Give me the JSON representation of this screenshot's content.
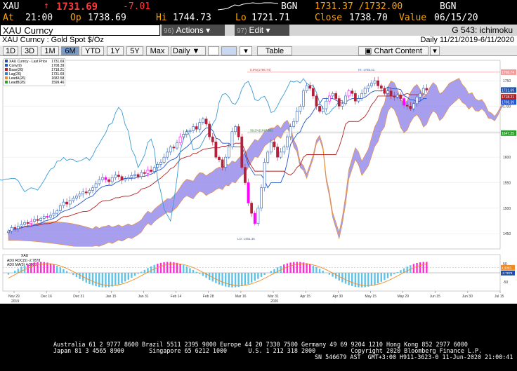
{
  "quote": {
    "ticker": "XAU",
    "arrow": "↑",
    "last": "1731.69",
    "change": "-7.01",
    "bgn_label": "BGN",
    "bid_ask": "1731.37 /1732.00",
    "bgn2": "BGN",
    "at_label": "At",
    "at_value": "21:00",
    "open_label": "Op",
    "open_value": "1738.69",
    "hi_label": "Hi",
    "hi_value": "1744.73",
    "lo_label": "Lo",
    "lo_value": "1721.71",
    "close_label": "Close",
    "close_value": "1738.70",
    "value_label": "Value",
    "value_date": "06/15/20"
  },
  "menu": {
    "security": "XAU Curncy",
    "actions_num": "96)",
    "actions_label": "Actions ▾",
    "edit_num": "97)",
    "edit_label": "Edit ▾",
    "function_title": "G 543: ichimoku"
  },
  "subbar": {
    "description": "XAU Curncy : Gold Spot   $/Oz",
    "period": "Daily   11/21/2019-6/11/2020"
  },
  "toolbar": {
    "buttons": [
      "1D",
      "3D",
      "1M",
      "6M",
      "YTD",
      "1Y",
      "5Y",
      "Max"
    ],
    "active": "6M",
    "frequency": "Daily ▼",
    "table": "Table",
    "chart_content": "Chart Content"
  },
  "legend": [
    {
      "name": "XAU Curncy - Last Price",
      "value": "1731.69",
      "color": "#1f4fa8"
    },
    {
      "name": "Conv(9)",
      "value": "1708.39",
      "color": "#2255cc"
    },
    {
      "name": "Base(26)",
      "value": "1718.21",
      "color": "#b22222"
    },
    {
      "name": "Lag(26)",
      "value": "1731.69",
      "color": "#3a7bd5"
    },
    {
      "name": "LeadA(26)",
      "value": "1682.58",
      "color": "#f08a24"
    },
    {
      "name": "LeadB(26)",
      "value": "1599.46",
      "color": "#2ca02c"
    }
  ],
  "annotations": {
    "fib_top": "0.0%(1766.74)",
    "fib_low": "38.2%(1647.68)",
    "hi_label": "HI: 1765.41",
    "lo_label": "LO: 1451.45",
    "fib_top_label": "1766.74",
    "fib_low_label": "1647.25"
  },
  "lower_panel": {
    "title": "XAU",
    "osc_name": "ADX ROC(5)",
    "osc_value": "-2.7878",
    "ma_name": "ADX MA(5)",
    "ma_value": "4.3083",
    "osc_label": "-2.7878",
    "ma_label": "4.3083"
  },
  "colors": {
    "up": "#2b5fb7",
    "down": "#b3203a",
    "highlight": "#ff00ff",
    "cloud": "#8a7fe8",
    "conv": "#2255cc",
    "base": "#b22222",
    "lag": "#3a9bd5",
    "fib_top": "#f29b9b",
    "fib_low": "#7ccf7c",
    "hist_pos": "#5ec3e6",
    "hist_neg": "#5ec3e6",
    "hist_extreme": "#ff2bd6",
    "ma": "#f08a24"
  },
  "chart_data": {
    "type": "candlestick",
    "title": "",
    "price_axis": {
      "min": 1420,
      "max": 1790,
      "ticks": [
        1450,
        1500,
        1550,
        1600,
        1650,
        1700,
        1750
      ]
    },
    "price_labels": [
      {
        "text": "1766.74",
        "value": 1766.74,
        "color": "#f29b9b"
      },
      {
        "text": "1731.69",
        "value": 1731.69,
        "color": "#1f4fa8"
      },
      {
        "text": "1718.21",
        "value": 1718.21,
        "color": "#b22222"
      },
      {
        "text": "1708.39",
        "value": 1708.39,
        "color": "#2255cc"
      },
      {
        "text": "1647.25",
        "value": 1647.25,
        "color": "#2ca02c"
      }
    ],
    "x_ticks": [
      "Nov 29",
      "Dec 16",
      "Dec 31",
      "Jan 15",
      "Jan 31",
      "Feb 14",
      "Feb 28",
      "Mar 16",
      "Mar 31",
      "Apr 15",
      "Apr 30",
      "May 15",
      "May 29",
      "Jun 15",
      "Jun 30",
      "Jul 15"
    ],
    "x_years": [
      {
        "text": "2019",
        "tick": "Nov 29"
      },
      {
        "text": "2020",
        "tick": "Mar 31"
      }
    ],
    "closes": [
      1455,
      1462,
      1460,
      1465,
      1468,
      1472,
      1470,
      1474,
      1478,
      1476,
      1480,
      1484,
      1482,
      1486,
      1490,
      1495,
      1505,
      1512,
      1508,
      1515,
      1520,
      1524,
      1528,
      1532,
      1530,
      1535,
      1540,
      1548,
      1556,
      1560,
      1556,
      1552,
      1560,
      1565,
      1562,
      1555,
      1558,
      1560,
      1564,
      1566,
      1562,
      1570,
      1568,
      1575,
      1572,
      1580,
      1586,
      1590,
      1600,
      1610,
      1620,
      1618,
      1628,
      1640,
      1645,
      1650,
      1652,
      1660,
      1655,
      1668,
      1675,
      1665,
      1640,
      1630,
      1600,
      1595,
      1580,
      1600,
      1620,
      1650,
      1660,
      1640,
      1580,
      1550,
      1510,
      1490,
      1470,
      1500,
      1540,
      1590,
      1610,
      1630,
      1620,
      1600,
      1610,
      1620,
      1640,
      1660,
      1670,
      1690,
      1700,
      1730,
      1740,
      1735,
      1720,
      1700,
      1690,
      1695,
      1710,
      1720,
      1725,
      1715,
      1700,
      1705,
      1720,
      1730,
      1725,
      1710,
      1715,
      1725,
      1735,
      1740,
      1745,
      1750,
      1740,
      1735,
      1725,
      1730,
      1720,
      1718,
      1722,
      1715,
      1702,
      1700,
      1695,
      1705,
      1718,
      1725,
      1735,
      1731.69
    ],
    "osc_axis": {
      "min": -100,
      "max": 100,
      "ticks": [
        50,
        0,
        -50
      ]
    }
  },
  "footer": {
    "line1": "Australia 61 2 9777 8600 Brazil 5511 2395 9000 Europe 44 20 7330 7500 Germany 49 69 9204 1210 Hong Kong 852 2977 6000",
    "line2": "Japan 81 3 4565 8900       Singapore 65 6212 1000      U.S. 1 212 318 2000          Copyright 2020 Bloomberg Finance L.P.",
    "line3": "SN 546679 AST  GMT+3:00 H911-3623-0 11-Jun-2020 21:00:41"
  }
}
